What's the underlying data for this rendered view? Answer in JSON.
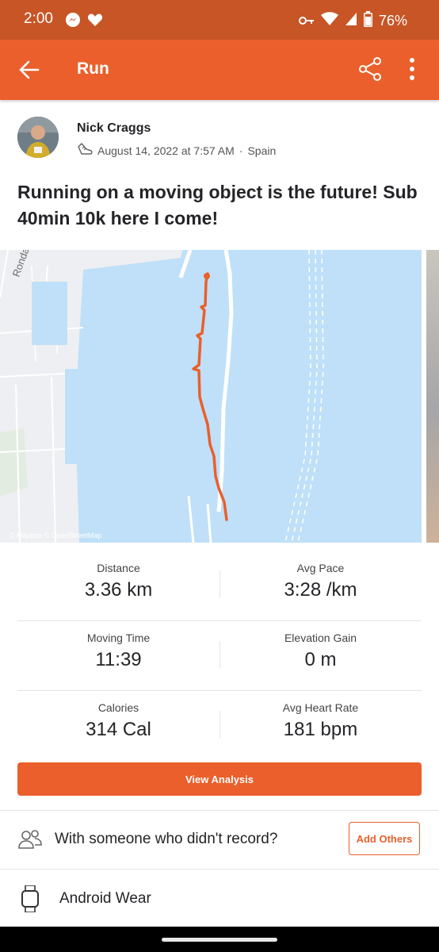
{
  "status_bar": {
    "time": "2:00",
    "battery": "76%"
  },
  "toolbar": {
    "title": "Run"
  },
  "athlete": {
    "name": "Nick Craggs",
    "date": "August 14, 2022 at 7:57 AM",
    "separator": "·",
    "location": "Spain"
  },
  "activity": {
    "title": "Running on a moving object is the future! Sub 40min 10k here I come!"
  },
  "map": {
    "street_label": "Ronda",
    "attribution": "© Mapbox © OpenStreetMap",
    "route_color": "#ea5f2b",
    "water_color": "#bfe0f8",
    "land_color": "#eeeff2"
  },
  "stats": {
    "rows": [
      [
        {
          "label": "Distance",
          "value": "3.36 km"
        },
        {
          "label": "Avg Pace",
          "value": "3:28 /km"
        }
      ],
      [
        {
          "label": "Moving Time",
          "value": "11:39"
        },
        {
          "label": "Elevation Gain",
          "value": "0 m"
        }
      ],
      [
        {
          "label": "Calories",
          "value": "314 Cal"
        },
        {
          "label": "Avg Heart Rate",
          "value": "181 bpm"
        }
      ]
    ]
  },
  "actions": {
    "view_analysis": "View Analysis",
    "with_someone": "With someone who didn't record?",
    "add_others": "Add Others"
  },
  "device": {
    "name": "Android Wear"
  },
  "colors": {
    "accent": "#ea5f2b",
    "status_bar": "#c75526"
  },
  "icons": [
    "messenger-icon",
    "heart-icon",
    "key-icon",
    "wifi-icon",
    "signal-icon",
    "battery-icon",
    "back-arrow-icon",
    "share-icon",
    "more-vert-icon",
    "shoe-icon",
    "people-icon",
    "watch-icon"
  ]
}
